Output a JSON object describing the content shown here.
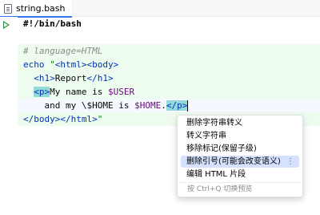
{
  "tab": {
    "file_name": "string.bash"
  },
  "editor": {
    "shebang": "#!/bin/bash",
    "comment": "# language=HTML",
    "l4": {
      "cmd": "echo",
      "q": "\"",
      "t1": "<html>",
      "t2": "<body>"
    },
    "l5": {
      "t1": "<h1>",
      "text": "Report",
      "t2": "</h1>"
    },
    "l6": {
      "t1": "<p>",
      "text1": "My name is ",
      "var": "$USER"
    },
    "l7": {
      "text1": "and my \\$HOME is ",
      "var": "$HOME",
      "text2": ".",
      "t1": "</p>"
    },
    "l8": {
      "t1": "</body>",
      "t2": "</html>",
      "q": "\""
    }
  },
  "context_menu": {
    "items": [
      "删除字符串转义",
      "转义字符串",
      "移除标记(保留子级)",
      "删除引号(可能会改变语义)",
      "编辑 HTML 片段"
    ],
    "selected_index": 3,
    "more_icon": "⋮",
    "hint": "按 Ctrl+Q 切换预览"
  }
}
